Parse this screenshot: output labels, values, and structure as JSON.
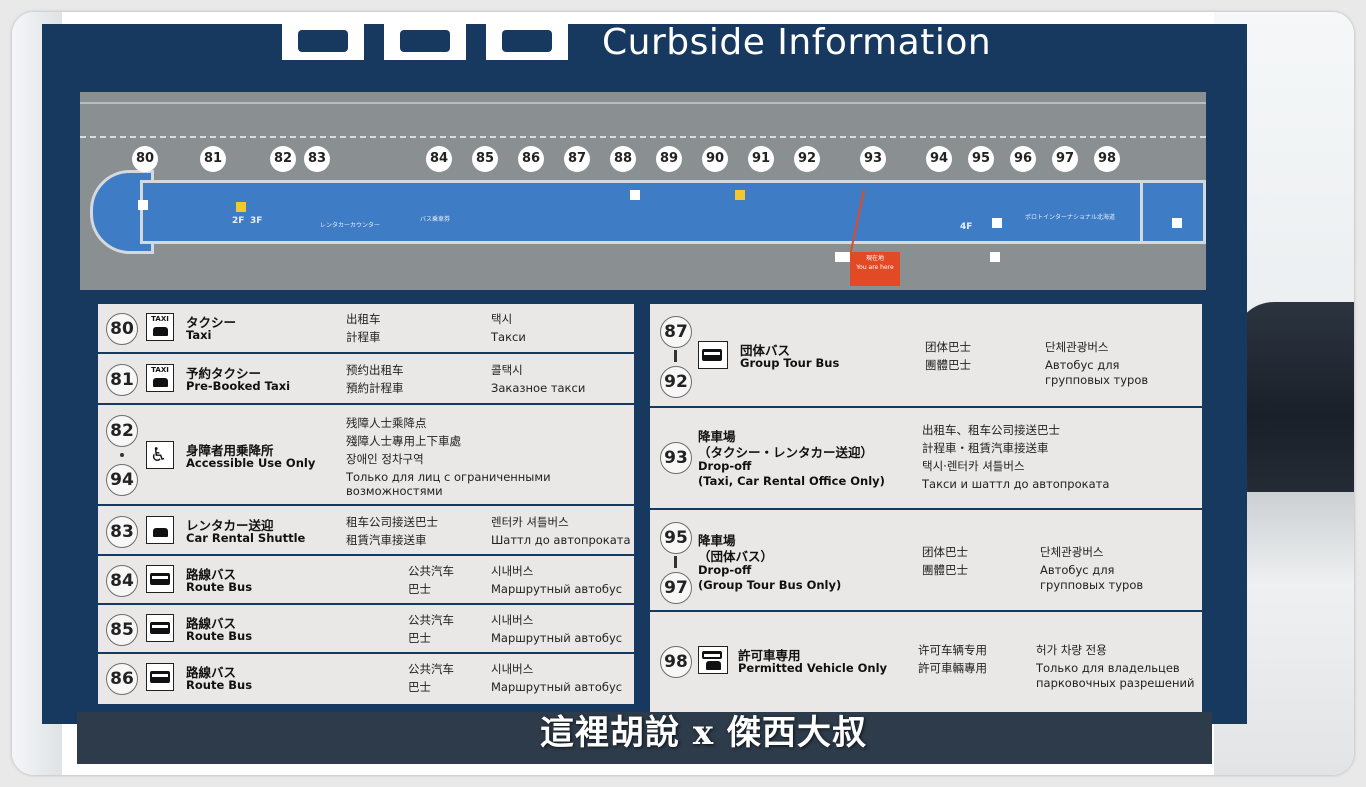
{
  "header": {
    "title": "Curbside Information"
  },
  "map": {
    "gates": [
      "80",
      "81",
      "82",
      "83",
      "84",
      "85",
      "86",
      "87",
      "88",
      "89",
      "90",
      "91",
      "92",
      "93",
      "94",
      "95",
      "96",
      "97",
      "98"
    ],
    "you_are_here_jp": "現在地",
    "you_are_here_en": "You are here",
    "labels": {
      "car_rental": "レンタカーカウンター",
      "bus_ticket": "バス乗車券",
      "international": "ポロトインターナショナル北海道",
      "floor_2f": "2F",
      "floor_3f": "3F",
      "floor_4f": "4F"
    }
  },
  "left_rows": [
    {
      "num_top": "80",
      "icon": "taxi-icon",
      "jp": "タクシー",
      "en": "Taxi",
      "c1": "出租车",
      "c2": "計程車",
      "k1": "택시",
      "k2": "Такси"
    },
    {
      "num_top": "81",
      "icon": "prebooked-taxi-icon",
      "jp": "予約タクシー",
      "en": "Pre-Booked Taxi",
      "c1": "预约出租车",
      "c2": "預約計程車",
      "k1": "콜택시",
      "k2": "Заказное такси"
    },
    {
      "num_top": "82",
      "num_bottom": "94",
      "icon": "wheelchair-icon",
      "jp": "身障者用乗降所",
      "en": "Accessible Use Only",
      "c1": "残障人士乘降点",
      "c2": "殘障人士專用上下車處",
      "c3": "장애인 정차구역",
      "c4": "Только для лиц с ограниченными",
      "c5": "возможностями"
    },
    {
      "num_top": "83",
      "icon": "car-rental-shuttle-icon",
      "jp": "レンタカー送迎",
      "en": "Car Rental Shuttle",
      "c1": "租车公司接送巴士",
      "c2": "租賃汽車接送車",
      "k1": "렌터카 셔틀버스",
      "k2": "Шаттл до автопроката"
    },
    {
      "num_top": "84",
      "icon": "bus-icon",
      "jp": "路線バス",
      "en": "Route Bus",
      "c1": "公共汽车",
      "c2": "巴士",
      "k1": "시내버스",
      "k2": "Маршрутный автобус"
    },
    {
      "num_top": "85",
      "icon": "bus-icon",
      "jp": "路線バス",
      "en": "Route Bus",
      "c1": "公共汽车",
      "c2": "巴士",
      "k1": "시내버스",
      "k2": "Маршрутный автобус"
    },
    {
      "num_top": "86",
      "icon": "bus-icon",
      "jp": "路線バス",
      "en": "Route Bus",
      "c1": "公共汽车",
      "c2": "巴士",
      "k1": "시내버스",
      "k2": "Маршрутный автобус"
    }
  ],
  "right_rows": [
    {
      "num_top": "87",
      "num_bottom": "92",
      "icon": "bus-icon",
      "jp": "団体バス",
      "en": "Group Tour Bus",
      "c1": "团体巴士",
      "c2": "團體巴士",
      "k1": "단체관광버스",
      "k2": "Автобус для",
      "k3": "групповых туров"
    },
    {
      "num_top": "93",
      "icon": "none",
      "jp": "降車場",
      "jp2": "（タクシー・レンタカー送迎）",
      "en": "Drop-off",
      "en2": "(Taxi, Car Rental Office Only)",
      "c1": "出租车、租车公司接送巴士",
      "c2": "計程車・租賃汽車接送車",
      "c3": "택시·렌터카 셔틀버스",
      "c4": "Такси и шаттл до автопроката"
    },
    {
      "num_top": "95",
      "num_bottom": "97",
      "icon": "none",
      "jp": "降車場",
      "jp2": "（団体バス）",
      "en": "Drop-off",
      "en2": "(Group Tour Bus Only)",
      "c1": "团体巴士",
      "c2": "團體巴士",
      "k1": "단체관광버스",
      "k2": "Автобус для",
      "k3": "групповых туров"
    },
    {
      "num_top": "98",
      "icon": "permitted-vehicle-icon",
      "jp": "許可車専用",
      "en": "Permitted Vehicle Only",
      "c1": "许可车辆专用",
      "c2": "許可車輛專用",
      "k1": "허가 차량 전용",
      "k2": "Только для владельцев",
      "k3": "парковочных разрешений"
    }
  ],
  "watermark": "這裡胡說 x 傑西大叔"
}
